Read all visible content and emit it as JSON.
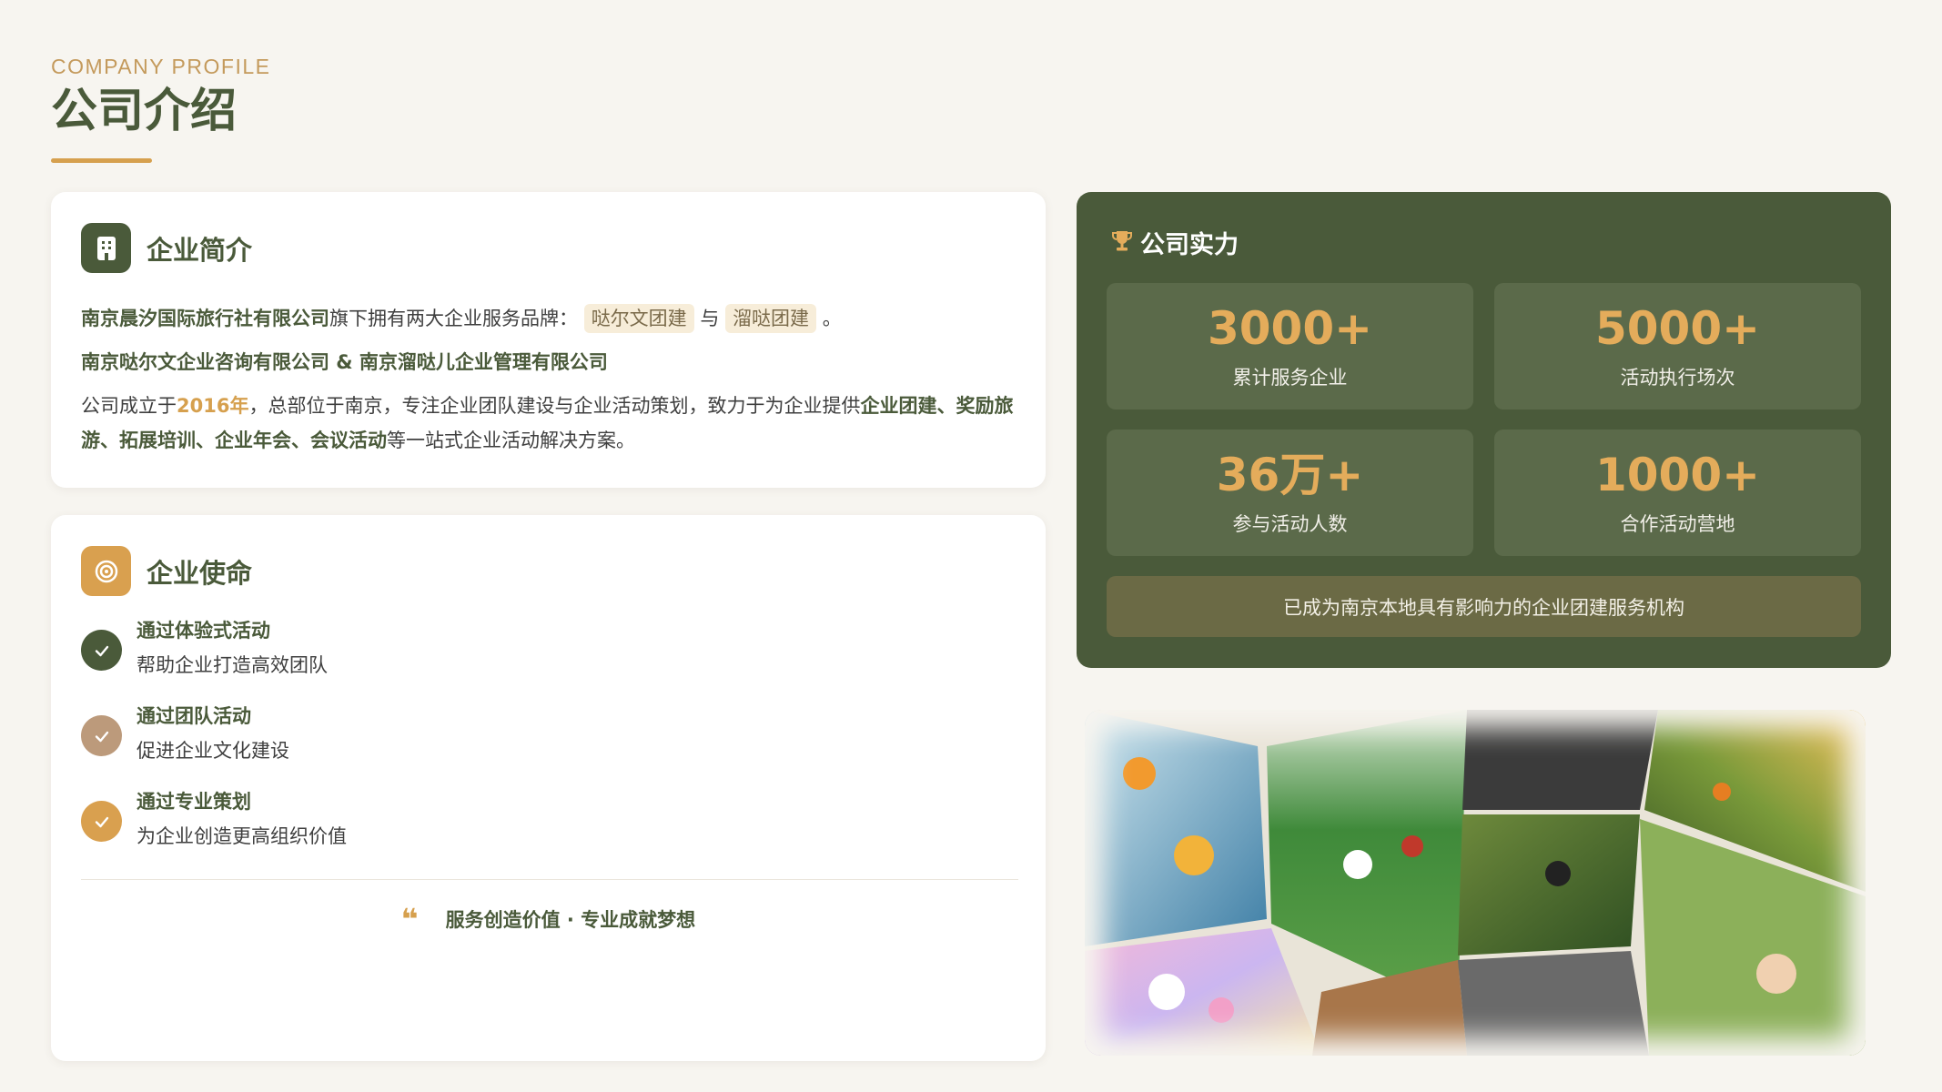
{
  "header": {
    "eyebrow": "COMPANY PROFILE",
    "title": "公司介绍"
  },
  "intro": {
    "icon": "building-icon",
    "title": "企业简介",
    "company_name": "南京晨汐国际旅行社有限公司",
    "brand_lead": "旗下拥有两大企业服务品牌：",
    "brand1": "哒尔文团建",
    "brand_and": "与",
    "brand2": "溜哒团建",
    "brand_end": "。",
    "subsidiaries": "南京哒尔文企业咨询有限公司 & 南京溜哒儿企业管理有限公司",
    "para_1": "公司成立于",
    "founded": "2016年",
    "para_2": "，总部位于南京，专注企业团队建设与企业活动策划，致力于为企业提供",
    "services": "企业团建、奖励旅游、拓展培训、企业年会、会议活动",
    "para_3": "等一站式企业活动解决方案。"
  },
  "mission": {
    "icon": "target-icon",
    "title": "企业使命",
    "items": [
      {
        "title": "通过体验式活动",
        "subtitle": "帮助企业打造高效团队",
        "color": "#4a5a3a"
      },
      {
        "title": "通过团队活动",
        "subtitle": "促进企业文化建设",
        "color": "#bc9a7b"
      },
      {
        "title": "通过专业策划",
        "subtitle": "为企业创造更高组织价值",
        "color": "#d9a04f"
      }
    ],
    "quote_mark": "❝",
    "motto": "服务创造价值 · 专业成就梦想"
  },
  "strength": {
    "icon": "trophy-icon",
    "title": "公司实力",
    "stats": [
      {
        "value": "3000+",
        "label": "累计服务企业"
      },
      {
        "value": "5000+",
        "label": "活动执行场次"
      },
      {
        "value": "36万+",
        "label": "参与活动人数"
      },
      {
        "value": "1000+",
        "label": "合作活动营地"
      }
    ],
    "banner": "已成为南京本地具有影响力的企业团建服务机构"
  },
  "colors": {
    "primary_green": "#4a5a3a",
    "accent_gold": "#d6a04e",
    "background": "#f7f5f0"
  }
}
